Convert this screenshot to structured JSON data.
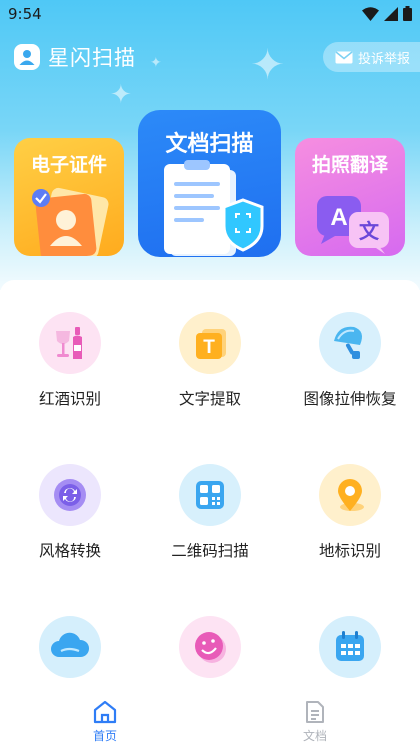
{
  "status_bar": {
    "time": "9:54"
  },
  "header": {
    "app_name": "星闪扫描",
    "complaint_label": "投诉举报"
  },
  "feature_cards": [
    {
      "label": "电子证件",
      "icon": "id-card-icon"
    },
    {
      "label": "文档扫描",
      "icon": "document-scan-icon"
    },
    {
      "label": "拍照翻译",
      "icon": "translate-icon",
      "glyph_a": "A",
      "glyph_b": "文"
    }
  ],
  "tools": [
    {
      "label": "红酒识别",
      "icon": "wine-icon"
    },
    {
      "label": "文字提取",
      "icon": "text-extract-icon",
      "glyph": "T"
    },
    {
      "label": "图像拉伸恢复",
      "icon": "image-stretch-icon"
    },
    {
      "label": "风格转换",
      "icon": "style-convert-icon"
    },
    {
      "label": "二维码扫描",
      "icon": "qr-code-icon"
    },
    {
      "label": "地标识别",
      "icon": "landmark-icon"
    },
    {
      "label": "",
      "icon": "cloud-icon"
    },
    {
      "label": "",
      "icon": "smile-face-icon"
    },
    {
      "label": "",
      "icon": "calendar-icon"
    }
  ],
  "bottom_nav": [
    {
      "label": "首页",
      "icon": "home-icon",
      "active": true
    },
    {
      "label": "文档",
      "icon": "document-icon",
      "active": false
    }
  ],
  "colors": {
    "accent": "#2f7df6",
    "inactive": "#b0b4bb"
  }
}
